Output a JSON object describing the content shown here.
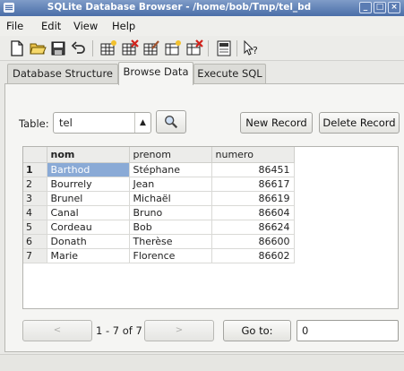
{
  "window": {
    "title": "SQLite Database Browser - /home/bob/Tmp/tel_bd",
    "controls": [
      "_",
      "□",
      "×"
    ]
  },
  "menu": [
    "File",
    "Edit",
    "View",
    "Help"
  ],
  "toolbar": {
    "icons": [
      "new-file-icon",
      "open-folder-icon",
      "save-icon",
      "undo-icon",
      "create-table-icon",
      "delete-table-icon",
      "modify-table-icon",
      "create-index-icon",
      "delete-index-icon",
      "log-icon",
      "whats-this-icon"
    ]
  },
  "tabs": [
    {
      "label": "Database Structure",
      "active": false
    },
    {
      "label": "Browse Data",
      "active": true
    },
    {
      "label": "Execute SQL",
      "active": false
    }
  ],
  "browse": {
    "table_label": "Table:",
    "table_value": "tel",
    "new_record": "New Record",
    "delete_record": "Delete Record"
  },
  "grid": {
    "columns": [
      "nom",
      "prenom",
      "numero"
    ],
    "rows": [
      {
        "n": "1",
        "nom": "Barthod",
        "prenom": "Stéphane",
        "numero": "86451"
      },
      {
        "n": "2",
        "nom": "Bourrely",
        "prenom": "Jean",
        "numero": "86617"
      },
      {
        "n": "3",
        "nom": "Brunel",
        "prenom": "Michaël",
        "numero": "86619"
      },
      {
        "n": "4",
        "nom": "Canal",
        "prenom": "Bruno",
        "numero": "86604"
      },
      {
        "n": "5",
        "nom": "Cordeau",
        "prenom": "Bob",
        "numero": "86624"
      },
      {
        "n": "6",
        "nom": "Donath",
        "prenom": "Therèse",
        "numero": "86600"
      },
      {
        "n": "7",
        "nom": "Marie",
        "prenom": "Florence",
        "numero": "86602"
      }
    ],
    "selected_row": 0,
    "selected_col": "nom"
  },
  "nav": {
    "prev": "<",
    "count": "1 - 7 of 7",
    "next": ">",
    "goto_label": "Go to:",
    "goto_value": "0"
  },
  "colors": {
    "titlebar": "#4a6ea8",
    "selection": "#8aaad6"
  }
}
